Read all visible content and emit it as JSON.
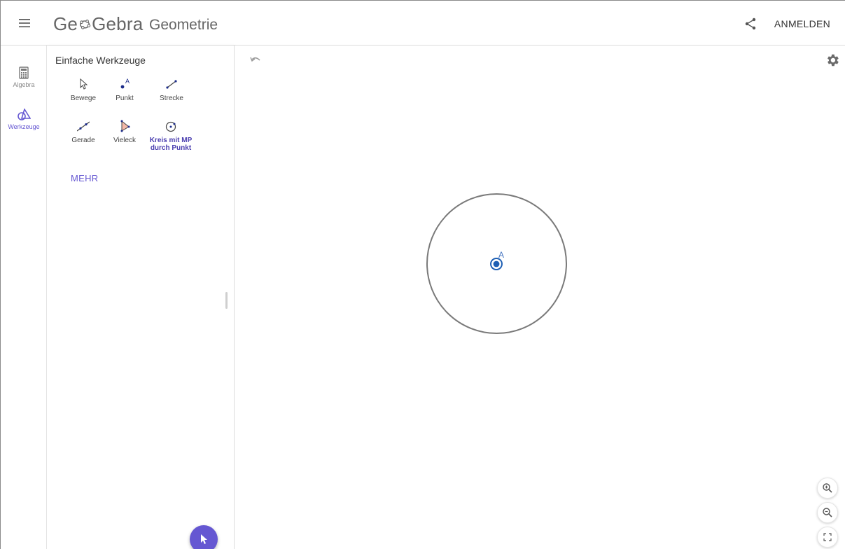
{
  "header": {
    "logo_text_before": "Ge",
    "logo_text_after": "Gebra",
    "app_title": "Geometrie",
    "login_label": "ANMELDEN",
    "icons": {
      "menu": "hamburger-menu-icon",
      "share": "share-icon"
    }
  },
  "rail": {
    "algebra_label": "Algebra",
    "tools_label": "Werkzeuge",
    "active_color": "#6557d2"
  },
  "tools_panel": {
    "title": "Einfache Werkzeuge",
    "tools": [
      {
        "label": "Bewege",
        "icon": "move-arrow-icon"
      },
      {
        "label": "Punkt",
        "icon": "point-icon"
      },
      {
        "label": "Strecke",
        "icon": "segment-icon"
      },
      {
        "label": "Gerade",
        "icon": "line-icon"
      },
      {
        "label": "Vieleck",
        "icon": "polygon-icon"
      },
      {
        "label": "Kreis mit MP\ndurch Punkt",
        "icon": "circle-center-point-icon",
        "selected": true
      }
    ],
    "more_label": "MEHR"
  },
  "canvas": {
    "point_name": "A",
    "circle_color": "#7a7a7a",
    "point_color": "#1e5fb4",
    "icons": {
      "undo": "undo-icon",
      "settings": "gear-icon",
      "zoom_in": "zoom-in-icon",
      "zoom_out": "zoom-out-icon",
      "fullscreen": "fullscreen-icon"
    }
  },
  "colors": {
    "accent": "#6557d2"
  }
}
